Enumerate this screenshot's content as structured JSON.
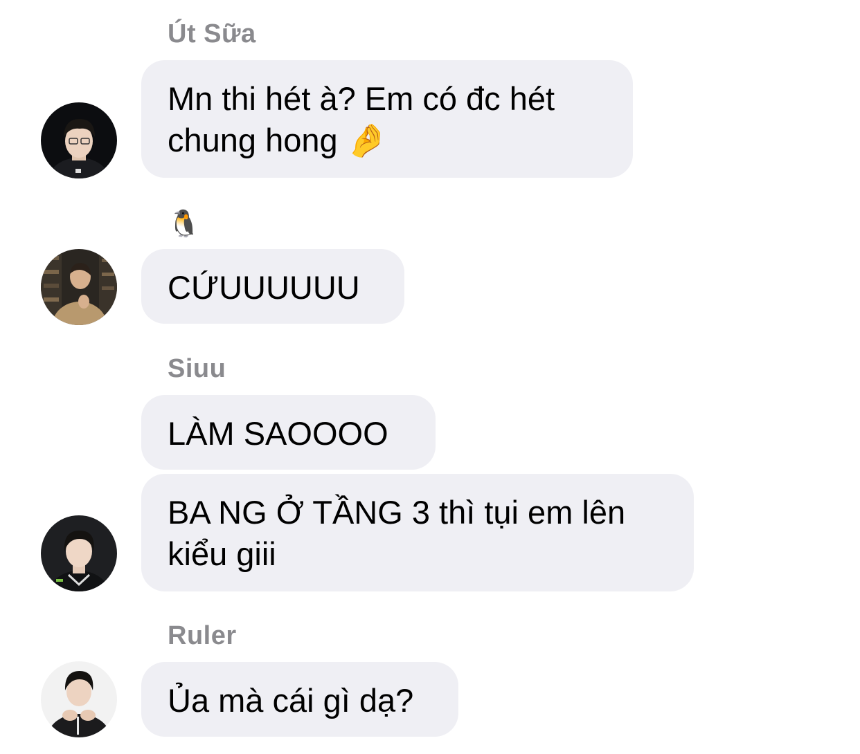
{
  "messages": [
    {
      "sender": "Út Sữa",
      "text": "Mn thi hét à? Em có đc hét\nchung hong 🤌"
    },
    {
      "sender": "🐧",
      "text": "CỨUUUUUU"
    },
    {
      "sender": "Siuu",
      "texts": [
        "LÀM SAOOOO",
        "BA NG Ở TẦNG 3 thì tụi em lên\nkiểu giii"
      ]
    },
    {
      "sender": "Ruler",
      "text": "Ủa mà cái gì dạ?"
    }
  ],
  "avatars": [
    "avatar-dark-hair-glasses",
    "avatar-library-background",
    "avatar-black-jacket",
    "avatar-clasped-hands"
  ],
  "colors": {
    "bubble": "#efeff4",
    "sender_name": "#8a8a8e"
  }
}
